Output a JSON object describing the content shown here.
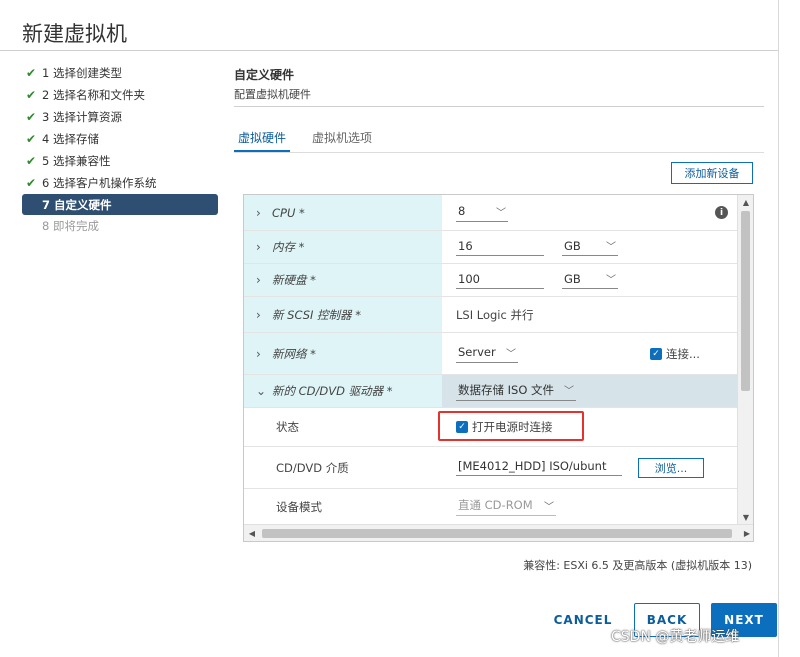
{
  "window": {
    "title": "新建虚拟机"
  },
  "steps": [
    {
      "label": "1 选择创建类型",
      "state": "done"
    },
    {
      "label": "2 选择名称和文件夹",
      "state": "done"
    },
    {
      "label": "3 选择计算资源",
      "state": "done"
    },
    {
      "label": "4 选择存储",
      "state": "done"
    },
    {
      "label": "5 选择兼容性",
      "state": "done"
    },
    {
      "label": "6 选择客户机操作系统",
      "state": "done"
    },
    {
      "label": "7 自定义硬件",
      "state": "active"
    },
    {
      "label": "8 即将完成",
      "state": "pending"
    }
  ],
  "section": {
    "title": "自定义硬件",
    "subtitle": "配置虚拟机硬件"
  },
  "tabs": [
    {
      "label": "虚拟硬件",
      "active": true
    },
    {
      "label": "虚拟机选项",
      "active": false
    }
  ],
  "add_device_label": "添加新设备",
  "hardware": {
    "cpu": {
      "label": "CPU *",
      "value": "8",
      "caret": "﹀",
      "chevron": "›"
    },
    "memory": {
      "label": "内存 *",
      "value": "16",
      "unit": "GB",
      "chevron": "›"
    },
    "disk": {
      "label": "新硬盘 *",
      "value": "100",
      "unit": "GB",
      "chevron": "›"
    },
    "scsi": {
      "label": "新 SCSI 控制器 *",
      "value": "LSI Logic 并行",
      "chevron": "›"
    },
    "network": {
      "label": "新网络 *",
      "value": "Server",
      "connect_label": "连接...",
      "chevron": "›"
    },
    "dvd": {
      "label": "新的 CD/DVD 驱动器 *",
      "value": "数据存储 ISO 文件",
      "chevron": "⌄",
      "status": {
        "label": "状态",
        "checkbox_label": "打开电源时连接"
      },
      "media": {
        "label": "CD/DVD 介质",
        "value": "[ME4012_HDD] ISO/ubunt",
        "browse_label": "浏览..."
      },
      "mode": {
        "label": "设备模式",
        "value": "直通 CD-ROM"
      }
    }
  },
  "compat": "兼容性: ESXi 6.5 及更高版本 (虚拟机版本 13)",
  "buttons": {
    "cancel": "CANCEL",
    "back": "BACK",
    "next": "NEXT"
  },
  "watermark": "CSDN @黄老师运维",
  "colors": {
    "accent": "#0b6fbd",
    "active_step": "#2f4f72",
    "check_green": "#2f8a2f",
    "label_bg": "#dff4f6",
    "highlight_box": "#e5322d"
  }
}
